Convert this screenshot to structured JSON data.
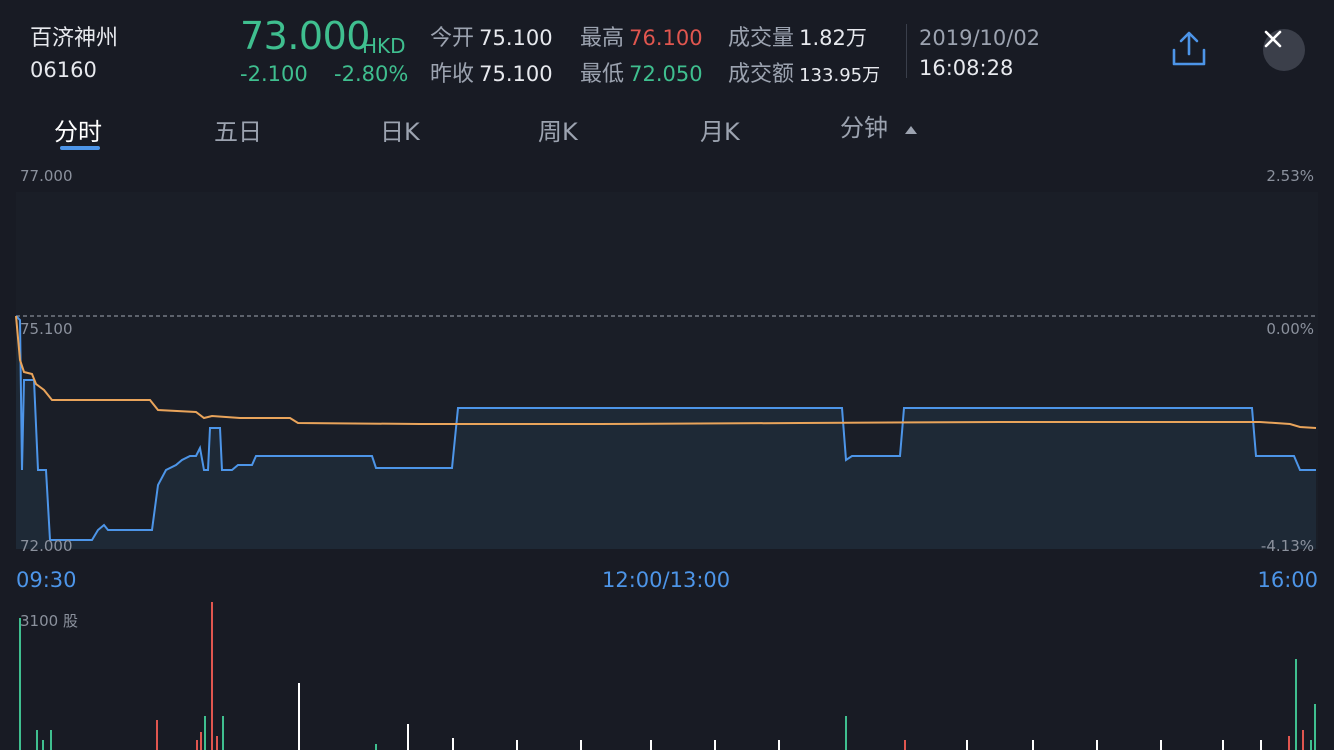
{
  "stock": {
    "name": "百济神州",
    "code": "06160",
    "price": "73.000",
    "currency": "HKD",
    "change": "-2.100",
    "change_pct": "-2.80%"
  },
  "stats": {
    "open_label": "今开",
    "open": "75.100",
    "prev_close_label": "昨收",
    "prev_close": "75.100",
    "high_label": "最高",
    "high": "76.100",
    "low_label": "最低",
    "low": "72.050",
    "volume_label": "成交量",
    "volume": "1.82万",
    "turnover_label": "成交额",
    "turnover": "133.95万"
  },
  "timestamp": {
    "date": "2019/10/02",
    "time": "16:08:28"
  },
  "icons": {
    "share": "share-icon",
    "close": "close-icon"
  },
  "tabs": [
    {
      "label": "分时",
      "active": true
    },
    {
      "label": "五日"
    },
    {
      "label": "日K"
    },
    {
      "label": "周K"
    },
    {
      "label": "月K"
    },
    {
      "label": "分钟"
    }
  ],
  "chart_axes": {
    "y_top": "77.000",
    "y_mid": "75.100",
    "y_bottom": "72.000",
    "pct_top": "2.53%",
    "pct_mid": "0.00%",
    "pct_bottom": "-4.13%",
    "t_start": "09:30",
    "t_mid": "12:00/13:00",
    "t_end": "16:00",
    "vol_label": "3100 股"
  },
  "colors": {
    "up": "#e0564f",
    "down": "#3fbf8f",
    "price_line": "#4d95e8",
    "avg_line": "#e9a45b",
    "bg": "#181b24"
  },
  "chart_data": {
    "type": "line",
    "ylim": [
      72.0,
      77.0
    ],
    "series": [
      {
        "values": [
          75.1,
          74.0,
          73.0,
          72.9,
          74.3,
          74.3,
          73.0,
          73.0,
          72.0,
          72.0,
          72.0,
          72.0,
          72.2,
          72.4,
          72.3,
          72.3,
          72.3,
          72.3,
          72.3,
          73.0,
          73.0,
          73.0,
          73.4,
          73.4,
          73.4,
          73.2,
          73.2,
          73.8,
          73.8,
          73.8,
          73.2,
          73.2,
          73.2,
          73.3,
          73.3,
          73.3,
          73.3,
          73.3,
          73.2,
          73.2,
          73.2,
          73.2,
          73.2,
          73.2,
          73.2,
          73.2,
          73.2,
          73.2,
          73.3,
          73.3,
          73.3,
          73.3,
          73.4,
          73.4,
          73.4,
          73.4,
          73.4,
          73.4,
          73.4,
          73.4,
          73.4,
          73.4,
          73.4,
          73.4,
          73.4,
          73.4,
          73.4,
          73.4,
          73.4,
          73.4,
          73.4,
          73.4,
          73.4,
          73.4,
          73.4,
          73.4,
          73.4,
          73.4,
          73.4,
          73.4,
          73.4,
          73.4,
          73.4,
          73.4,
          73.4,
          73.4,
          73.4,
          73.4,
          73.4,
          73.4,
          73.4,
          73.4,
          73.4,
          73.4,
          73.4,
          73.4,
          73.4,
          73.3,
          73.3,
          73.3,
          73.3,
          73.3,
          73.3,
          73.3,
          73.3,
          73.3,
          73.3,
          73.3,
          73.3,
          73.3,
          73.3,
          73.3,
          73.3,
          73.2,
          73.2,
          73.2,
          73.2,
          73.2,
          73.2,
          73.2,
          73.2,
          73.2,
          73.2,
          73.2,
          73.2,
          73.2,
          73.2,
          73.2,
          73.2,
          73.2,
          73.2,
          73.2,
          73.2,
          73.2,
          73.2,
          73.2,
          73.2,
          73.2,
          73.2,
          73.2,
          73.2,
          73.2,
          73.2,
          73.2,
          73.2,
          73.2,
          73.2,
          73.2,
          73.2,
          73.3,
          73.3,
          73.3,
          73.3,
          73.3,
          73.3,
          73.3,
          73.3,
          73.3,
          73.3,
          73.3,
          73.3,
          73.3,
          73.3,
          73.3,
          73.3,
          73.3,
          73.3,
          73.3,
          73.3,
          73.3,
          73.3,
          73.3,
          73.3,
          73.3,
          73.3,
          73.3,
          73.3,
          73.3,
          73.3,
          73.3,
          73.3,
          73.3,
          73.3,
          73.3,
          73.3,
          73.3,
          73.3,
          73.3,
          73.3,
          73.3,
          73.3,
          73.3,
          73.3,
          73.3,
          73.3,
          73.3,
          73.3,
          73.3,
          73.3,
          73.3,
          73.3,
          73.3,
          73.3,
          73.3,
          73.3,
          73.3,
          73.3,
          73.3,
          73.3,
          73.3,
          73.3,
          73.3,
          73.3,
          73.3,
          73.3,
          73.3,
          73.3,
          73.3,
          73.3,
          73.3,
          73.3,
          73.3,
          73.3,
          73.3,
          73.3,
          73.3,
          73.3,
          73.3,
          73.3,
          73.3,
          73.3,
          73.3,
          73.3,
          73.3,
          73.3,
          73.3,
          73.3,
          73.3,
          73.3,
          73.3,
          73.3,
          73.3,
          73.3,
          73.3,
          73.3,
          73.3,
          73.3,
          73.3,
          73.3,
          73.3,
          73.3,
          73.3,
          73.3,
          73.3,
          73.3,
          73.3,
          73.3,
          73.3,
          73.3,
          73.3,
          73.3,
          73.3,
          73.3,
          73.3,
          73.3,
          73.3,
          73.3,
          73.3,
          73.3,
          73.3,
          73.3,
          73.3,
          73.3,
          73.3,
          73.3,
          73.3,
          73.3,
          73.3,
          73.3,
          73.3,
          73.3,
          73.3,
          73.3,
          73.3,
          73.3,
          73.3,
          73.3,
          73.3,
          73.3,
          73.3,
          73.3,
          73.3,
          73.3,
          73.3,
          73.3,
          73.3,
          73.3,
          73.3,
          73.3,
          73.3,
          73.3,
          73.3,
          73.3,
          73.3,
          73.3,
          73.3,
          73.3,
          73.3,
          73.3,
          73.3,
          73.3,
          73.3,
          73.3,
          73.3,
          73.0,
          73.0,
          73.0
        ]
      }
    ]
  }
}
